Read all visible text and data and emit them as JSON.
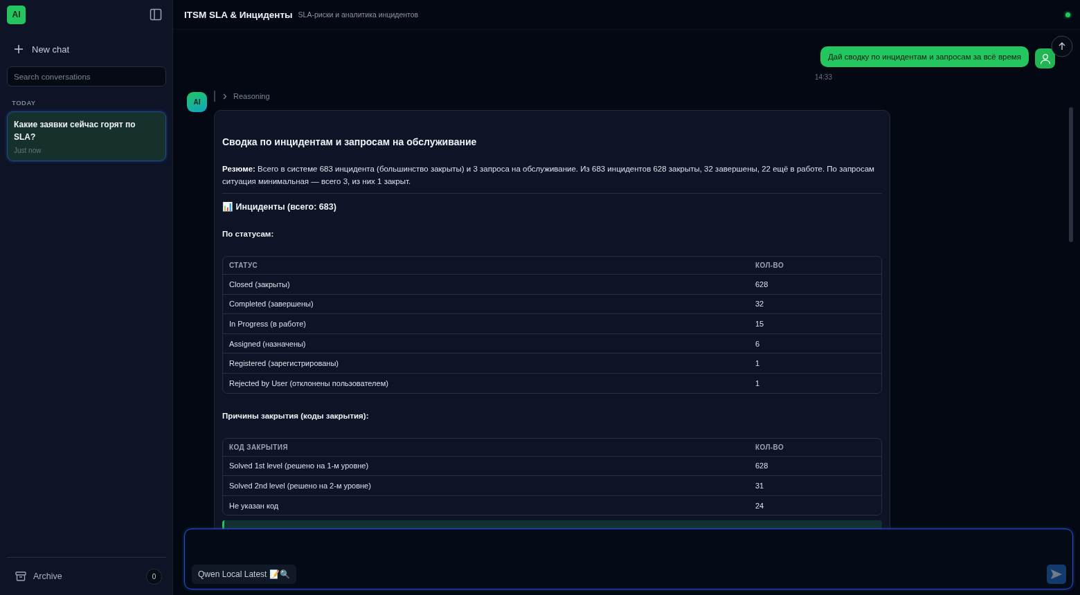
{
  "sidebar": {
    "logo": "AI",
    "new_chat": "New chat",
    "search": {
      "placeholder": "Search conversations"
    },
    "section": "TODAY",
    "conversations": [
      {
        "title": "Какие заявки сейчас горят по SLA?",
        "time": "Just now",
        "selected": true
      }
    ],
    "archive": {
      "label": "Archive",
      "count": "0"
    }
  },
  "header": {
    "title": "ITSM SLA & Инциденты",
    "subtitle": "SLA-риски и аналитика инцидентов",
    "online": true
  },
  "messages": [
    {
      "kind": "user",
      "text": "Дай сводку по инцидентам и запросам за всё время",
      "time": "14:33"
    },
    {
      "kind": "assistant",
      "avatar": "AI",
      "reasoning": "Reasoning",
      "title": "Сводка по инцидентам и запросам на обслуживание",
      "blocks": [
        {
          "kind": "paragraph",
          "text": "**Резюме:** Всего в системе 683 инцидента (большинство закрыты) и 3 запроса на обслуживание. Из 683 инцидентов 628 закрыты, 32 завершены, 22 ещё в работе. По запросам ситуация минимальная — всего 3, из них 1 закрыт."
        },
        {
          "kind": "rule"
        },
        {
          "kind": "heading",
          "text": "📊 Инциденты (всего: 683)"
        },
        {
          "kind": "subheading",
          "text": "По статусам:"
        },
        {
          "kind": "table",
          "columns": [
            "СТАТУС",
            "КОЛ-ВО"
          ],
          "rows": [
            [
              "Closed (закрыты)",
              "628"
            ],
            [
              "Completed (завершены)",
              "32"
            ],
            [
              "In Progress (в работе)",
              "15"
            ],
            [
              "Assigned (назначены)",
              "6"
            ],
            [
              "Registered (зарегистрированы)",
              "1"
            ],
            [
              "Rejected by User (отклонены пользователем)",
              "1"
            ]
          ]
        },
        {
          "kind": "subheading",
          "text": "Причины закрытия (коды закрытия):"
        },
        {
          "kind": "table",
          "columns": [
            "КОД ЗАКРЫТИЯ",
            "КОЛ-ВО"
          ],
          "rows": [
            [
              "Solved 1st level (решено на 1-м уровне)",
              "628"
            ],
            [
              "Solved 2nd level (решено на 2-м уровне)",
              "31"
            ],
            [
              "Не указан код",
              "24"
            ]
          ]
        },
        {
          "kind": "callout"
        }
      ]
    }
  ],
  "composer": {
    "model": "Qwen Local Latest 📝🔍"
  }
}
